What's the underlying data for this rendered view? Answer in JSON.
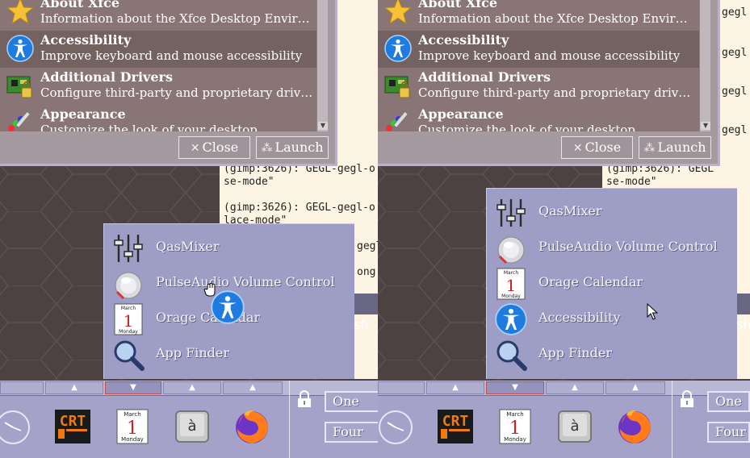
{
  "terminal": {
    "lines_left": [
      "gegl-o",
      "gegl-o",
      "gegl-o",
      "gegl-o",
      "(gimp:3626): GEGL-gegl-o",
      "se-mode\"",
      "(gimp:3626): GEGL-gegl-o",
      "lace-mode\"",
      "gegl-o",
      "ong"
    ],
    "lines_right": [
      "gegl",
      "gegl",
      "gegl",
      "gegl",
      "(gimp:3626): GEGL",
      "se-mode\""
    ],
    "bar_left": "sh",
    "bar_right": "sh"
  },
  "settings": {
    "items": [
      {
        "title": "About Xfce",
        "desc": "Information about the Xfce Desktop Envir…",
        "icon": "star-icon"
      },
      {
        "title": "Accessibility",
        "desc": "Improve keyboard and mouse accessibility",
        "icon": "accessibility-icon"
      },
      {
        "title": "Additional Drivers",
        "desc": "Configure third-party and proprietary driv…",
        "icon": "circuit-board-icon"
      },
      {
        "title": "Appearance",
        "desc": "Customize the look of your desktop",
        "icon": "paint-brush-icon"
      }
    ],
    "close_label": "Close",
    "launch_label": "Launch",
    "close_glyph": "✕",
    "launch_glyph": "⁂"
  },
  "popup_left": {
    "items": [
      {
        "label": "QasMixer",
        "icon": "mixer-sliders-icon"
      },
      {
        "label": "PulseAudio Volume Control",
        "icon": "speaker-icon"
      },
      {
        "label": "Orage Calendar",
        "icon": "calendar-icon"
      },
      {
        "label": "App Finder",
        "icon": "magnifier-icon"
      }
    ]
  },
  "popup_right": {
    "items": [
      {
        "label": "QasMixer",
        "icon": "mixer-sliders-icon"
      },
      {
        "label": "PulseAudio Volume Control",
        "icon": "speaker-icon"
      },
      {
        "label": "Orage Calendar",
        "icon": "calendar-icon"
      },
      {
        "label": "Accessibility",
        "icon": "accessibility-icon"
      },
      {
        "label": "App Finder",
        "icon": "magnifier-icon"
      }
    ]
  },
  "calendar": {
    "month": "March",
    "day": "1",
    "weekday": "Monday"
  },
  "crt": {
    "text": "CRT"
  },
  "keyboard_key": {
    "char": "à"
  },
  "workspaces": {
    "one": "One",
    "four": "Four"
  },
  "colors": {
    "popup_bg": "#9d9dc6",
    "panel_bg": "#a4a2c8",
    "settings_bg": "#8a7576",
    "terminal_bg": "#fdf4e4",
    "accent_blue": "#1e7be0"
  }
}
